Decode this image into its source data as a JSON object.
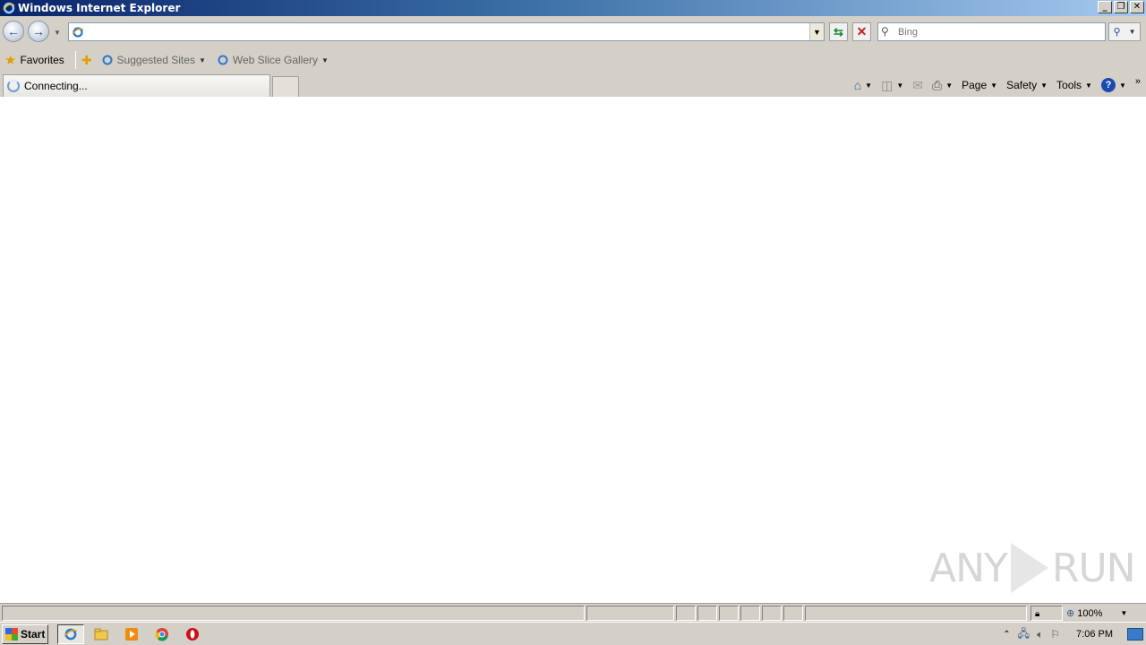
{
  "window": {
    "title": "Windows Internet Explorer",
    "min_label": "_",
    "restore_label": "❐",
    "close_label": "✕"
  },
  "nav": {
    "back_glyph": "←",
    "forward_glyph": "→",
    "address_value": "",
    "search_placeholder": "Bing"
  },
  "favorites": {
    "label": "Favorites",
    "links": [
      {
        "label": "Suggested Sites"
      },
      {
        "label": "Web Slice Gallery"
      }
    ]
  },
  "tabs": {
    "active_label": "Connecting..."
  },
  "commands": {
    "page": "Page",
    "safety": "Safety",
    "tools": "Tools",
    "help": "?"
  },
  "status": {
    "zoom": "100%"
  },
  "taskbar": {
    "start_label": "Start",
    "clock": "7:06 PM"
  },
  "watermark": {
    "left": "ANY",
    "right": "RUN"
  },
  "icons": [
    "ie-icon",
    "back-arrow-icon",
    "forward-arrow-icon",
    "refresh-icon",
    "stop-icon",
    "search-icon",
    "favorites-star-icon",
    "add-favorite-icon",
    "home-icon",
    "feeds-icon",
    "mail-icon",
    "print-icon",
    "help-icon",
    "loading-spinner-icon",
    "windows-flag-icon",
    "folder-icon",
    "media-player-icon",
    "chrome-icon",
    "opera-icon",
    "show-desktop-icon"
  ],
  "colors": {
    "titlebar_start": "#0a246a",
    "titlebar_end": "#a6caf0",
    "chrome_bg": "#d4d0c8",
    "refresh_green": "#1c8a2c",
    "stop_red": "#c02020"
  }
}
